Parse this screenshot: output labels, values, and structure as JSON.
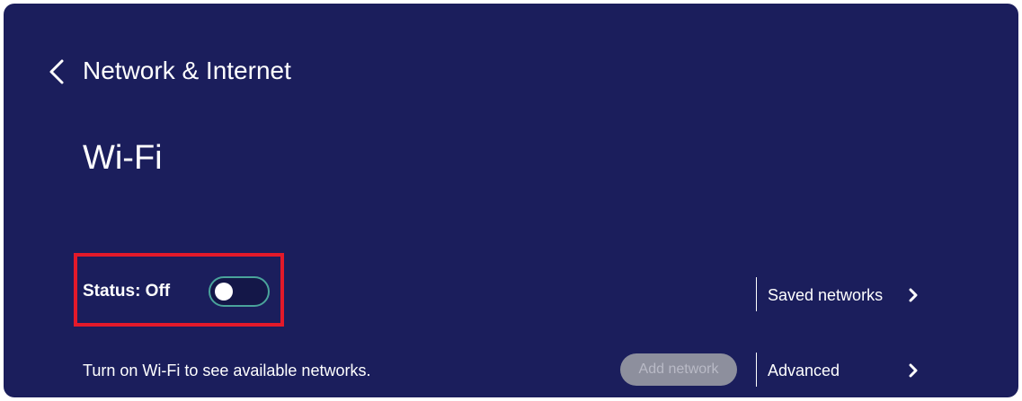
{
  "header": {
    "back_icon": "chevron-left-icon",
    "title": "Network & Internet"
  },
  "page": {
    "title": "Wi-Fi"
  },
  "wifi": {
    "status_label": "Status: Off",
    "toggle_on": false,
    "hint": "Turn on Wi-Fi to see available networks.",
    "add_network_label": "Add network"
  },
  "side_menu": {
    "saved_networks_label": "Saved networks",
    "advanced_label": "Advanced",
    "chevron_icon": "chevron-right-icon"
  },
  "colors": {
    "background": "#1b1e5c",
    "highlight_border": "#e3192a",
    "toggle_border": "#4aa39b",
    "disabled_button": "#8d8f9d"
  }
}
